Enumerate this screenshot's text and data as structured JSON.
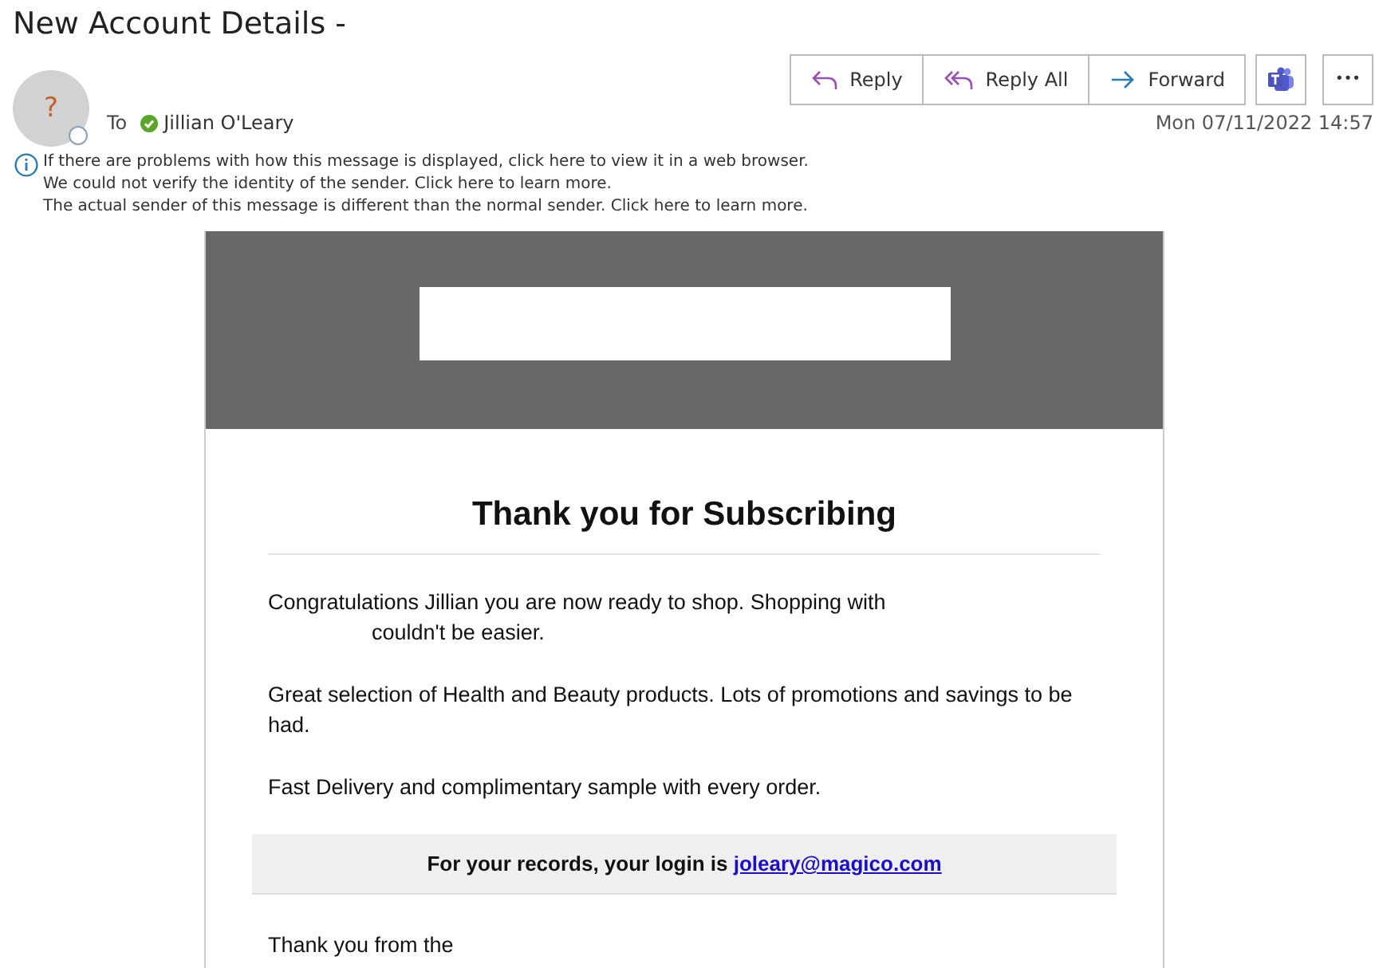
{
  "message": {
    "subject": "New Account Details -",
    "avatar_glyph": "?",
    "to_label": "To",
    "recipient": "Jillian O'Leary",
    "date": "Mon 07/11/2022 14:57"
  },
  "actions": [
    {
      "kind": "reply",
      "label": "Reply"
    },
    {
      "kind": "reply_all",
      "label": "Reply All"
    },
    {
      "kind": "forward",
      "label": "Forward"
    }
  ],
  "tool_buttons": [
    {
      "kind": "teams"
    },
    {
      "kind": "more",
      "label": "•••"
    }
  ],
  "info_lines": [
    "If there are problems with how this message is displayed, click here to view it in a web browser.",
    "We could not verify the identity of the sender. Click here to learn more.",
    "The actual sender of this message is different than the normal sender. Click here to learn more."
  ],
  "email": {
    "heading": "Thank you for Subscribing",
    "paragraphs": [
      {
        "lines": [
          "Congratulations Jillian you are now ready to shop. Shopping with",
          "couldn't be easier."
        ]
      },
      {
        "lines": [
          "Great selection of Health and Beauty products. Lots of promotions and savings to be had."
        ]
      },
      {
        "lines": [
          "Fast Delivery and complimentary sample with every order."
        ]
      }
    ],
    "login_text": "For your records, your login is",
    "login_email": "joleary@magico.com",
    "closing": "Thank you from the"
  }
}
